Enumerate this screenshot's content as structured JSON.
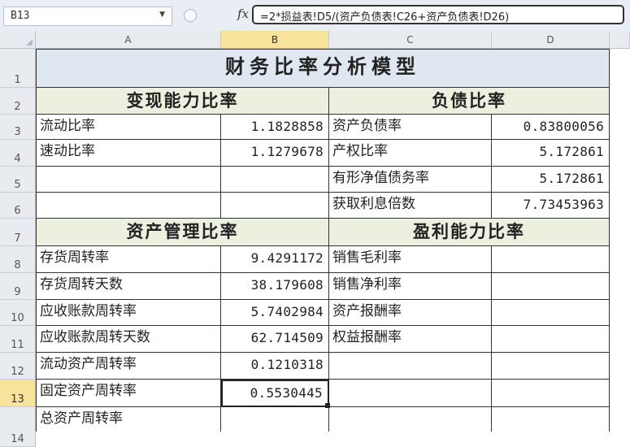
{
  "formula_bar": {
    "name_box": "B13",
    "fx_label": "fx",
    "formula": "=2*损益表!D5/(资产负债表!C26+资产负债表!D26)"
  },
  "columns": [
    "A",
    "B",
    "C",
    "D"
  ],
  "rows": [
    "1",
    "2",
    "3",
    "4",
    "5",
    "6",
    "7",
    "8",
    "9",
    "10",
    "11",
    "12",
    "13",
    "14"
  ],
  "selected_cell": "B13",
  "sheet": {
    "title": "财务比率分析模型",
    "sections": {
      "liquidity": "变现能力比率",
      "debt": "负债比率",
      "asset_mgmt": "资产管理比率",
      "profitability": "盈利能力比率"
    },
    "liquidity_rows": [
      {
        "label": "流动比率",
        "value": "1.1828858"
      },
      {
        "label": "速动比率",
        "value": "1.1279678"
      }
    ],
    "debt_rows": [
      {
        "label": "资产负债率",
        "value": "0.83800056"
      },
      {
        "label": "产权比率",
        "value": "5.172861"
      },
      {
        "label": "有形净值债务率",
        "value": "5.172861"
      },
      {
        "label": "获取利息倍数",
        "value": "7.73453963"
      }
    ],
    "asset_rows": [
      {
        "label": "存货周转率",
        "value": "9.4291172"
      },
      {
        "label": "存货周转天数",
        "value": "38.179608"
      },
      {
        "label": "应收账款周转率",
        "value": "5.7402984"
      },
      {
        "label": "应收账款周转天数",
        "value": "62.714509"
      },
      {
        "label": "流动资产周转率",
        "value": "0.1210318"
      },
      {
        "label": "固定资产周转率",
        "value": "0.5530445"
      },
      {
        "label": "总资产周转率",
        "value": ""
      }
    ],
    "profit_rows": [
      {
        "label": "销售毛利率",
        "value": ""
      },
      {
        "label": "销售净利率",
        "value": ""
      },
      {
        "label": "资产报酬率",
        "value": ""
      },
      {
        "label": "权益报酬率",
        "value": ""
      }
    ]
  }
}
